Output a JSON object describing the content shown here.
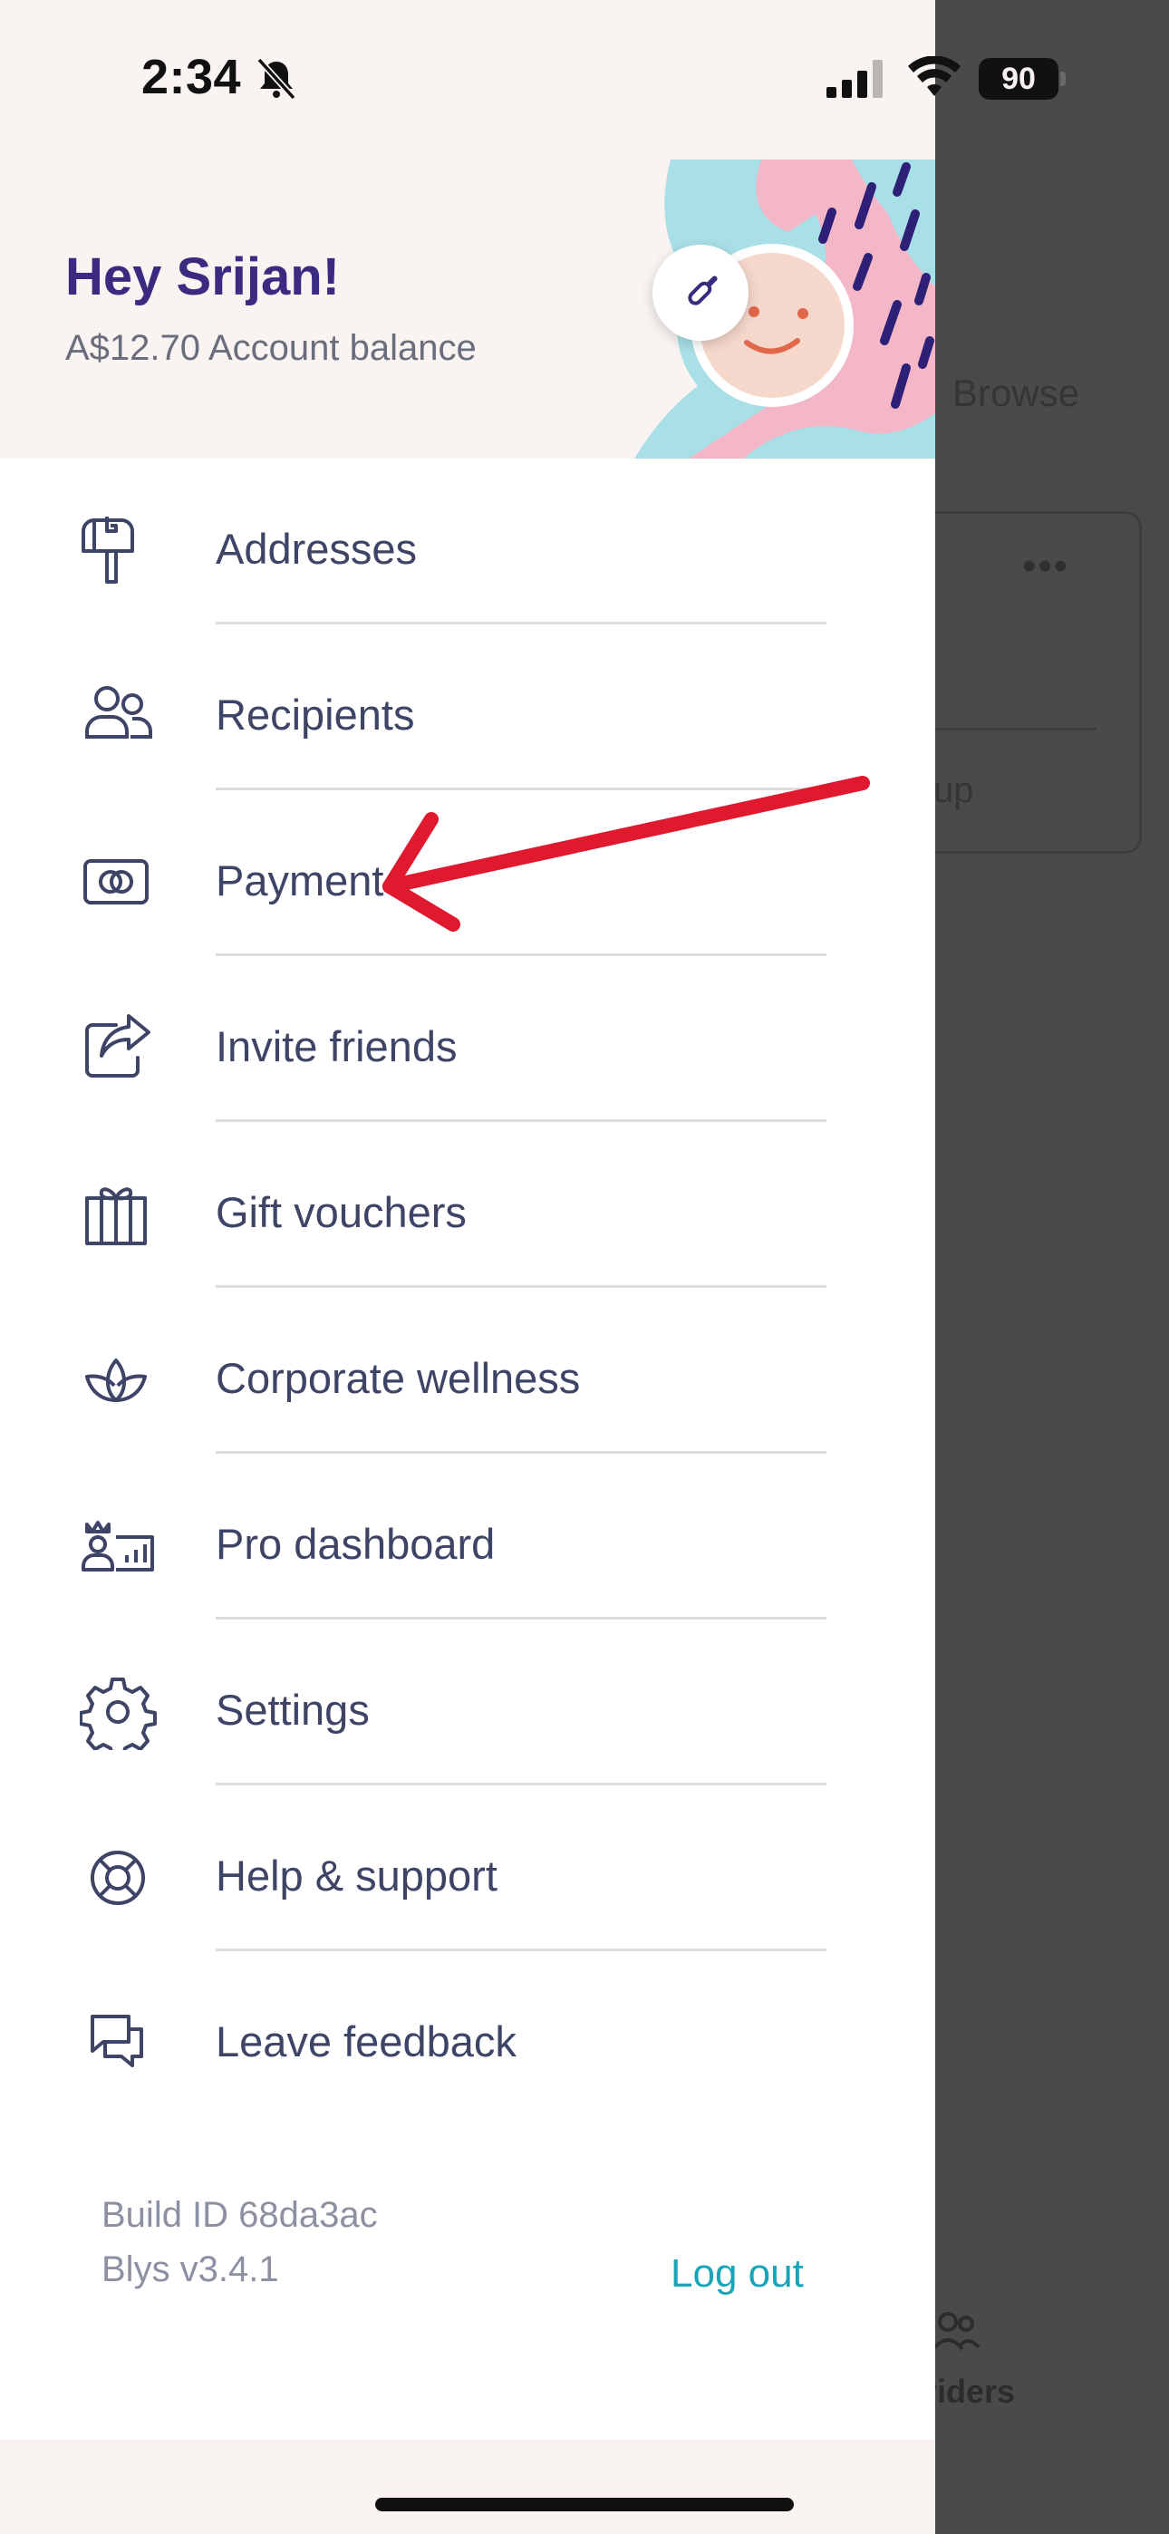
{
  "status_bar": {
    "time": "2:34",
    "battery": "90",
    "icons": [
      "bell-slash-icon",
      "cellular-signal-icon",
      "wifi-icon",
      "battery-icon"
    ]
  },
  "drawer": {
    "greeting": "Hey Srijan!",
    "balance": "A$12.70",
    "balance_label": "Account balance",
    "edit_icon": "pencil-icon",
    "menu": [
      {
        "label": "Addresses",
        "icon": "mailbox-icon"
      },
      {
        "label": "Recipients",
        "icon": "people-icon"
      },
      {
        "label": "Payment",
        "icon": "card-icon"
      },
      {
        "label": "Invite friends",
        "icon": "share-icon"
      },
      {
        "label": "Gift vouchers",
        "icon": "gift-icon"
      },
      {
        "label": "Corporate wellness",
        "icon": "lotus-icon"
      },
      {
        "label": "Pro dashboard",
        "icon": "pro-dashboard-icon"
      },
      {
        "label": "Settings",
        "icon": "gear-icon"
      },
      {
        "label": "Help & support",
        "icon": "lifebuoy-icon"
      },
      {
        "label": "Leave feedback",
        "icon": "chat-bubbles-icon"
      }
    ],
    "footer": {
      "build_id": "Build ID 68da3ac",
      "version": "Blys v3.4.1",
      "logout": "Log out"
    }
  },
  "background": {
    "browse_tab": "Browse",
    "card_button_partial": "up",
    "bottom_tab_partial": "riders"
  },
  "colors": {
    "accent": "#3a2b80",
    "menu_text": "#3d4466",
    "logout": "#18a5b8",
    "annotation": "#e0192e"
  }
}
